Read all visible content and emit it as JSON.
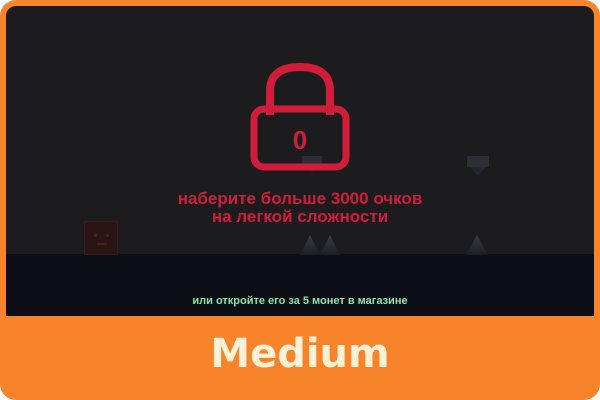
{
  "level": {
    "difficulty_label": "Medium",
    "locked": true,
    "lock_counter": "0",
    "unlock_requirement_line1": "наберите больше 3000 очков",
    "unlock_requirement_line2": "на легкой сложности",
    "store_hint": "или откройте его за 5 монет в магазине"
  },
  "colors": {
    "card_background": "#f7842a",
    "screen_background": "#1c1c1e",
    "ground": "#0c0f16",
    "lock_red": "#d21d3a",
    "store_hint_green": "#8fe0a6",
    "label_text": "#fff1d6"
  },
  "icons": {
    "lock": "lock-icon",
    "player": "player-cube",
    "obstacle": "spike-icon"
  }
}
